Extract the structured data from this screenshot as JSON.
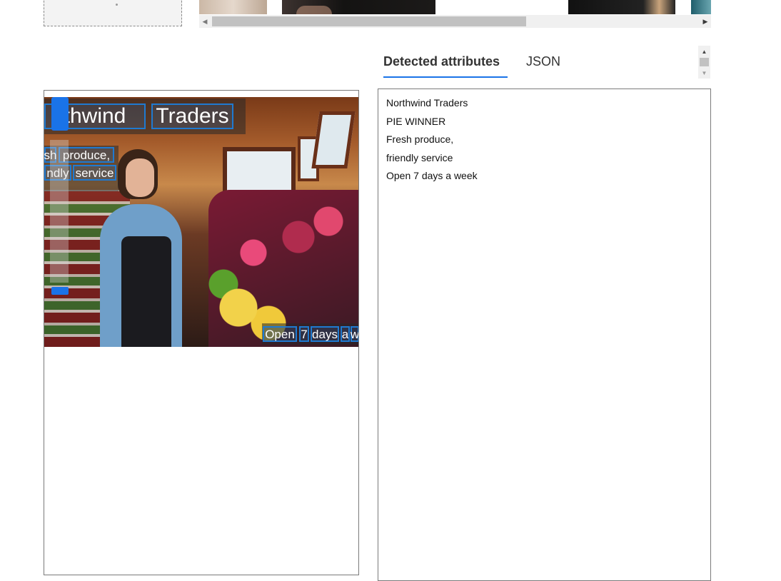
{
  "tabs": {
    "detected": "Detected attributes",
    "json": "JSON"
  },
  "ocr": {
    "line1": [
      "thwind",
      "Traders"
    ],
    "line2": [
      "sh",
      "produce,"
    ],
    "line3": [
      "ndly",
      "service"
    ],
    "line4": [
      "Open",
      "7",
      "days",
      "a",
      "w"
    ]
  },
  "attributes": [
    "Northwind Traders",
    "PIE WINNER",
    "Fresh produce,",
    "friendly service",
    "Open 7 days a week"
  ],
  "colors": {
    "accent": "#1a73e8",
    "ocr_box": "#1f7ad1",
    "scrollbar": "#c1c1c1"
  },
  "icons": {
    "scroll_left": "triangle-left",
    "scroll_right": "triangle-right",
    "scroll_up": "triangle-up",
    "scroll_down": "triangle-down"
  }
}
